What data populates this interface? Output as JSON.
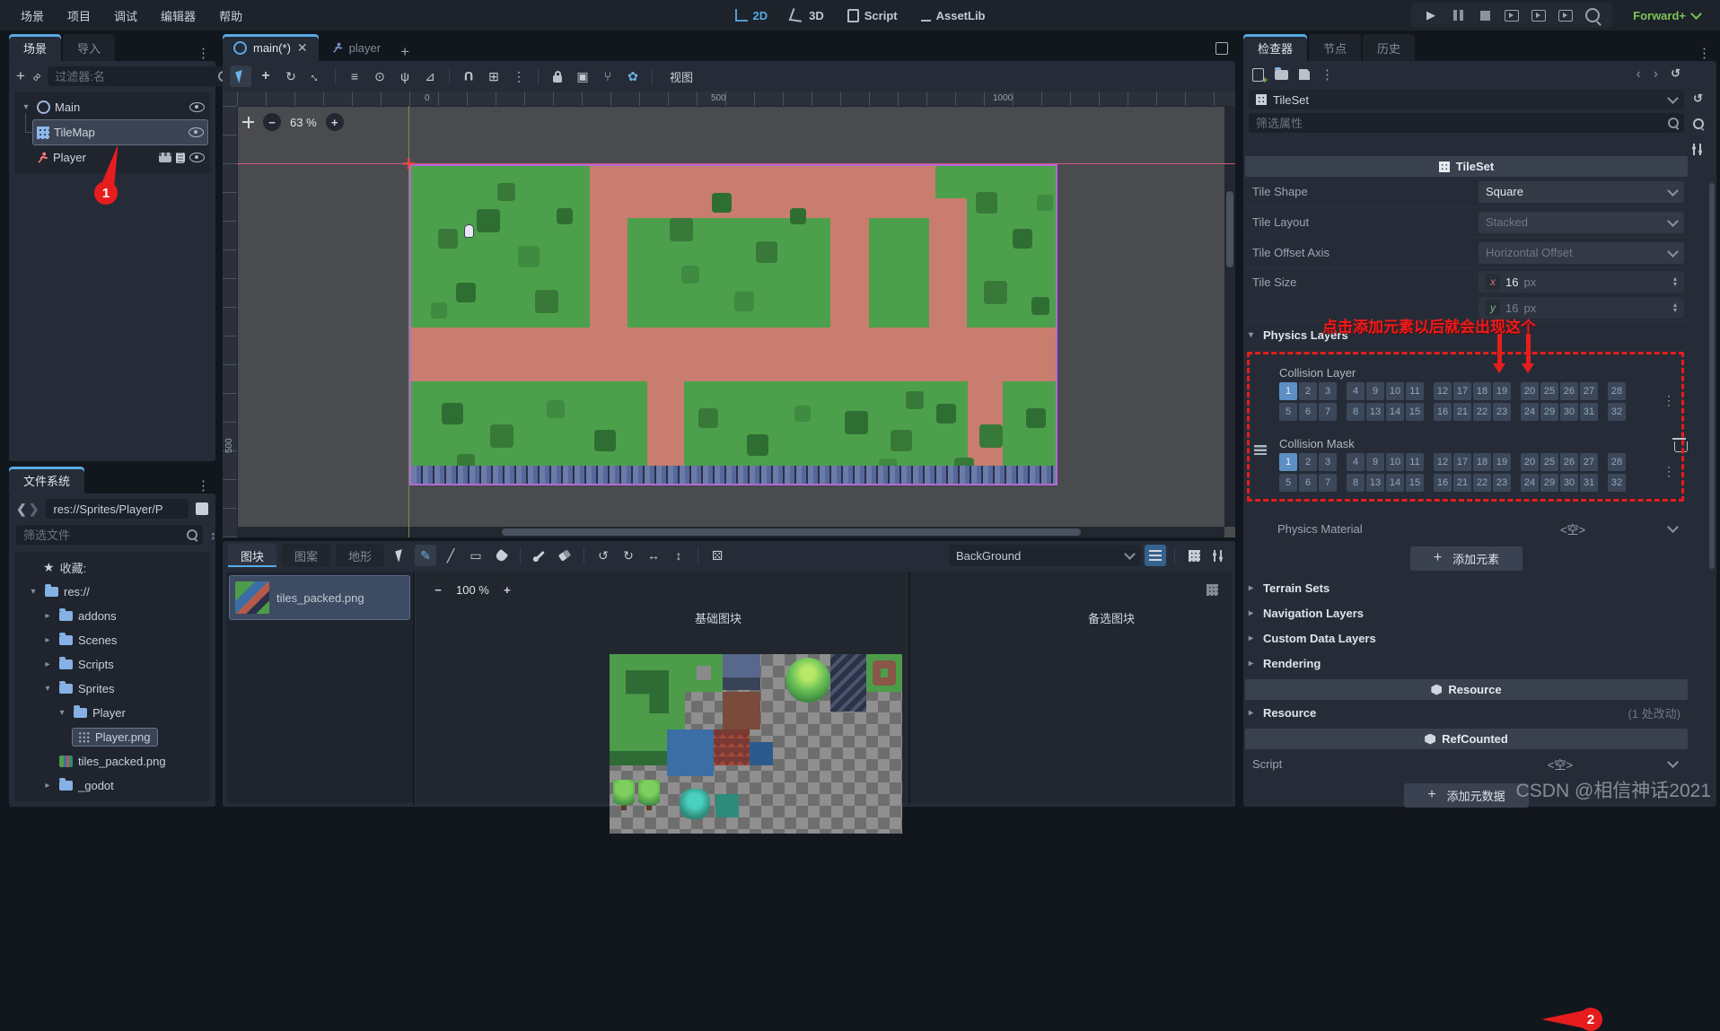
{
  "colors": {
    "accent": "#58aae4",
    "annotation_red": "#e71d1d",
    "grass": "#4da04b",
    "road": "#c87d6e",
    "selected_bit": "#5d8fc4"
  },
  "menubar": {
    "items": [
      "场景",
      "项目",
      "调试",
      "编辑器",
      "帮助"
    ]
  },
  "switcher": {
    "items": [
      {
        "label": "2D",
        "icon": "2d",
        "active": true
      },
      {
        "label": "3D",
        "icon": "3d"
      },
      {
        "label": "Script",
        "icon": "script"
      },
      {
        "label": "AssetLib",
        "icon": "assetlib"
      }
    ]
  },
  "playbar": {
    "renderer": "Forward+"
  },
  "scene_dock": {
    "tabs": [
      {
        "label": "场景",
        "active": true
      },
      {
        "label": "导入"
      }
    ],
    "filter_placeholder": "过滤器:名",
    "nodes": {
      "root": "Main",
      "tilemap": "TileMap",
      "player": "Player"
    }
  },
  "filesystem": {
    "tab": "文件系统",
    "path": "res://Sprites/Player/P",
    "filter_placeholder": "筛选文件",
    "favorites_label": "收藏:",
    "items": {
      "res": "res://",
      "addons": "addons",
      "scenes": "Scenes",
      "scripts": "Scripts",
      "sprites": "Sprites",
      "player": "Player",
      "player_png": "Player.png",
      "tiles_png": "tiles_packed.png",
      "godot": "_godot"
    }
  },
  "scene_tabs": {
    "main": "main(*)",
    "player": "player"
  },
  "canvas": {
    "view_menu": "视图",
    "zoom": "63 %",
    "ruler_h": [
      "0",
      "500",
      "1000"
    ],
    "ruler_v": "500"
  },
  "tile_editor": {
    "tabs": [
      {
        "label": "图块",
        "active": true
      },
      {
        "label": "图案"
      },
      {
        "label": "地形"
      }
    ],
    "layer_select": "BackGround",
    "source_item": "tiles_packed.png",
    "zoom": "100 %",
    "base_label": "基础图块",
    "alt_label": "备选图块"
  },
  "inspector": {
    "tabs": [
      {
        "label": "检查器",
        "active": true
      },
      {
        "label": "节点"
      },
      {
        "label": "历史"
      }
    ],
    "resource_name": "TileSet",
    "filter_placeholder": "筛选属性",
    "category": "TileSet",
    "props": {
      "tile_shape": {
        "label": "Tile Shape",
        "value": "Square"
      },
      "tile_layout": {
        "label": "Tile Layout",
        "value": "Stacked"
      },
      "tile_offset_axis": {
        "label": "Tile Offset Axis",
        "value": "Horizontal Offset"
      },
      "tile_size": {
        "label": "Tile Size",
        "x_badge": "x",
        "x_value": "16",
        "y_badge": "y",
        "y_value": "16",
        "unit": "px"
      }
    },
    "physics": {
      "section": "Physics Layers",
      "collision_layer_label": "Collision Layer",
      "collision_mask_label": "Collision Mask",
      "layer_row1": [
        {
          "n": "1",
          "on": true
        },
        {
          "n": "2"
        },
        {
          "n": "3"
        },
        {
          "n": "4"
        },
        {
          "n": "9"
        },
        {
          "n": "10"
        },
        {
          "n": "11"
        },
        {
          "n": "12"
        },
        {
          "n": "17"
        },
        {
          "n": "18"
        },
        {
          "n": "19"
        },
        {
          "n": "20"
        },
        {
          "n": "25"
        },
        {
          "n": "26"
        },
        {
          "n": "27"
        },
        {
          "n": "28"
        }
      ],
      "layer_row2": [
        {
          "n": "5"
        },
        {
          "n": "6"
        },
        {
          "n": "7"
        },
        {
          "n": "8"
        },
        {
          "n": "13"
        },
        {
          "n": "14"
        },
        {
          "n": "15"
        },
        {
          "n": "16"
        },
        {
          "n": "21"
        },
        {
          "n": "22"
        },
        {
          "n": "23"
        },
        {
          "n": "24"
        },
        {
          "n": "29"
        },
        {
          "n": "30"
        },
        {
          "n": "31"
        },
        {
          "n": "32"
        }
      ],
      "mask_row1": [
        {
          "n": "1",
          "on": true
        },
        {
          "n": "2"
        },
        {
          "n": "3"
        },
        {
          "n": "4"
        },
        {
          "n": "9"
        },
        {
          "n": "10"
        },
        {
          "n": "11"
        },
        {
          "n": "12"
        },
        {
          "n": "17"
        },
        {
          "n": "18"
        },
        {
          "n": "19"
        },
        {
          "n": "20"
        },
        {
          "n": "25"
        },
        {
          "n": "26"
        },
        {
          "n": "27"
        },
        {
          "n": "28"
        }
      ],
      "mask_row2": [
        {
          "n": "5"
        },
        {
          "n": "6"
        },
        {
          "n": "7"
        },
        {
          "n": "8"
        },
        {
          "n": "13"
        },
        {
          "n": "14"
        },
        {
          "n": "15"
        },
        {
          "n": "16"
        },
        {
          "n": "21"
        },
        {
          "n": "22"
        },
        {
          "n": "23"
        },
        {
          "n": "24"
        },
        {
          "n": "29"
        },
        {
          "n": "30"
        },
        {
          "n": "31"
        },
        {
          "n": "32"
        }
      ],
      "material_label": "Physics Material",
      "material_value": "<空>",
      "add_element": "添加元素"
    },
    "sections": [
      {
        "label": "Terrain Sets"
      },
      {
        "label": "Navigation Layers"
      },
      {
        "label": "Custom Data Layers"
      },
      {
        "label": "Rendering"
      }
    ],
    "resource_category": "Resource",
    "resource_section": {
      "label": "Resource",
      "note": "(1 处改动)"
    },
    "refcounted_category": "RefCounted",
    "script": {
      "label": "Script",
      "value": "<空>"
    },
    "add_metadata": "添加元数据"
  },
  "annotation": {
    "note": "点击添加元素以后就会出现这个",
    "badge1": "1",
    "badge2": "2"
  },
  "watermark": "CSDN @相信神话2021"
}
